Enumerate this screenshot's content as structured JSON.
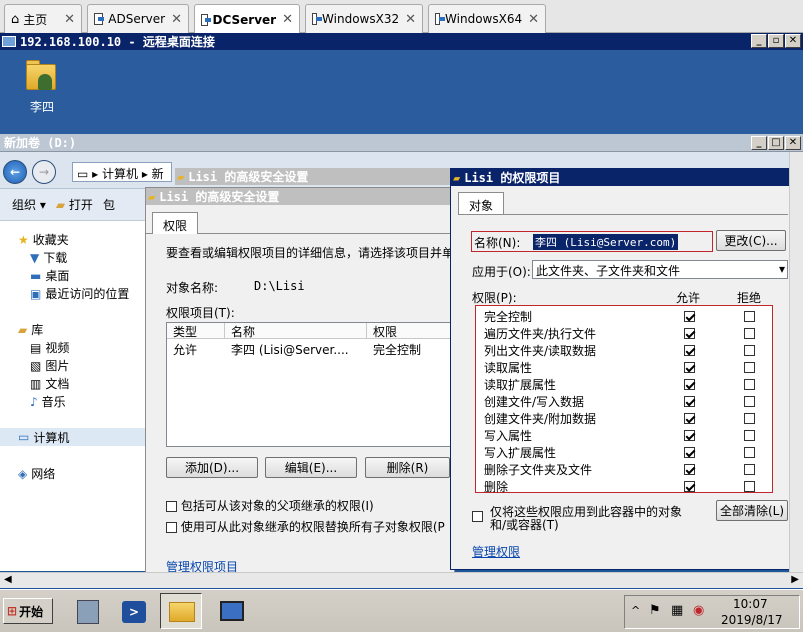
{
  "browser_tabs": [
    {
      "label": "主页"
    },
    {
      "label": "ADServer"
    },
    {
      "label": "DCServer",
      "active": true
    },
    {
      "label": "WindowsX32"
    },
    {
      "label": "WindowsX64"
    }
  ],
  "rdp": {
    "title": "192.168.100.10 - 远程桌面连接",
    "btn_min": "_",
    "btn_restore": "▫",
    "btn_close": "✕"
  },
  "desktop": {
    "icon_label": "李四"
  },
  "explorer": {
    "title": "新加卷 (D:)",
    "address_computer": "计算机",
    "address_next": "新",
    "cmd_organize": "组织",
    "cmd_open": "打开",
    "cmd_more": "包",
    "nav": {
      "favorites": "收藏夹",
      "downloads": "下载",
      "desktop": "桌面",
      "recent": "最近访问的位置",
      "libraries": "库",
      "videos": "视频",
      "pictures": "图片",
      "documents": "文档",
      "music": "音乐",
      "computer": "计算机",
      "network": "网络"
    }
  },
  "adv_dialog_back": {
    "title": "Lisi 的高级安全设置"
  },
  "adv_dialog": {
    "title": "Lisi 的高级安全设置",
    "tab": "权限",
    "instruction": "要查看或编辑权限项目的详细信息，请选择该项目并单",
    "object_label": "对象名称:",
    "object_value": "D:\\Lisi",
    "entries_label": "权限项目(T):",
    "columns": [
      "类型",
      "名称",
      "权限"
    ],
    "rows": [
      {
        "type": "允许",
        "name": "李四 (Lisi@Server....",
        "perm": "完全控制"
      }
    ],
    "btn_add": "添加(D)...",
    "btn_edit": "编辑(E)...",
    "btn_delete": "删除(R)",
    "cb_inherit": "包括可从该对象的父项继承的权限(I)",
    "cb_replace": "使用可从此对象继承的权限替换所有子对象权限(P",
    "link_manage": "管理权限项目"
  },
  "perm_dialog": {
    "title": "Lisi 的权限项目",
    "tab": "对象",
    "name_label": "名称(N):",
    "name_value": "李四 (Lisi@Server.com)",
    "btn_change": "更改(C)...",
    "applyto_label": "应用于(O):",
    "applyto_value": "此文件夹、子文件夹和文件",
    "perms_label": "权限(P):",
    "col_allow": "允许",
    "col_deny": "拒绝",
    "permissions": [
      {
        "name": "完全控制",
        "allow": true,
        "deny": false
      },
      {
        "name": "遍历文件夹/执行文件",
        "allow": true,
        "deny": false
      },
      {
        "name": "列出文件夹/读取数据",
        "allow": true,
        "deny": false
      },
      {
        "name": "读取属性",
        "allow": true,
        "deny": false
      },
      {
        "name": "读取扩展属性",
        "allow": true,
        "deny": false
      },
      {
        "name": "创建文件/写入数据",
        "allow": true,
        "deny": false
      },
      {
        "name": "创建文件夹/附加数据",
        "allow": true,
        "deny": false
      },
      {
        "name": "写入属性",
        "allow": true,
        "deny": false
      },
      {
        "name": "写入扩展属性",
        "allow": true,
        "deny": false
      },
      {
        "name": "删除子文件夹及文件",
        "allow": true,
        "deny": false
      },
      {
        "name": "删除",
        "allow": true,
        "deny": false
      }
    ],
    "cb_apply_line1": "仅将这些权限应用到此容器中的对象",
    "cb_apply_line2": "和/或容器(T)",
    "btn_clear": "全部清除(L)",
    "link_manage": "管理权限"
  },
  "taskbar": {
    "start": "开始",
    "time": "10:07",
    "date": "2019/8/17"
  },
  "colors": {
    "rdp_title": "#0a246a",
    "highlight_red": "#c0272d",
    "desktop_blue": "#2a5c9e"
  }
}
